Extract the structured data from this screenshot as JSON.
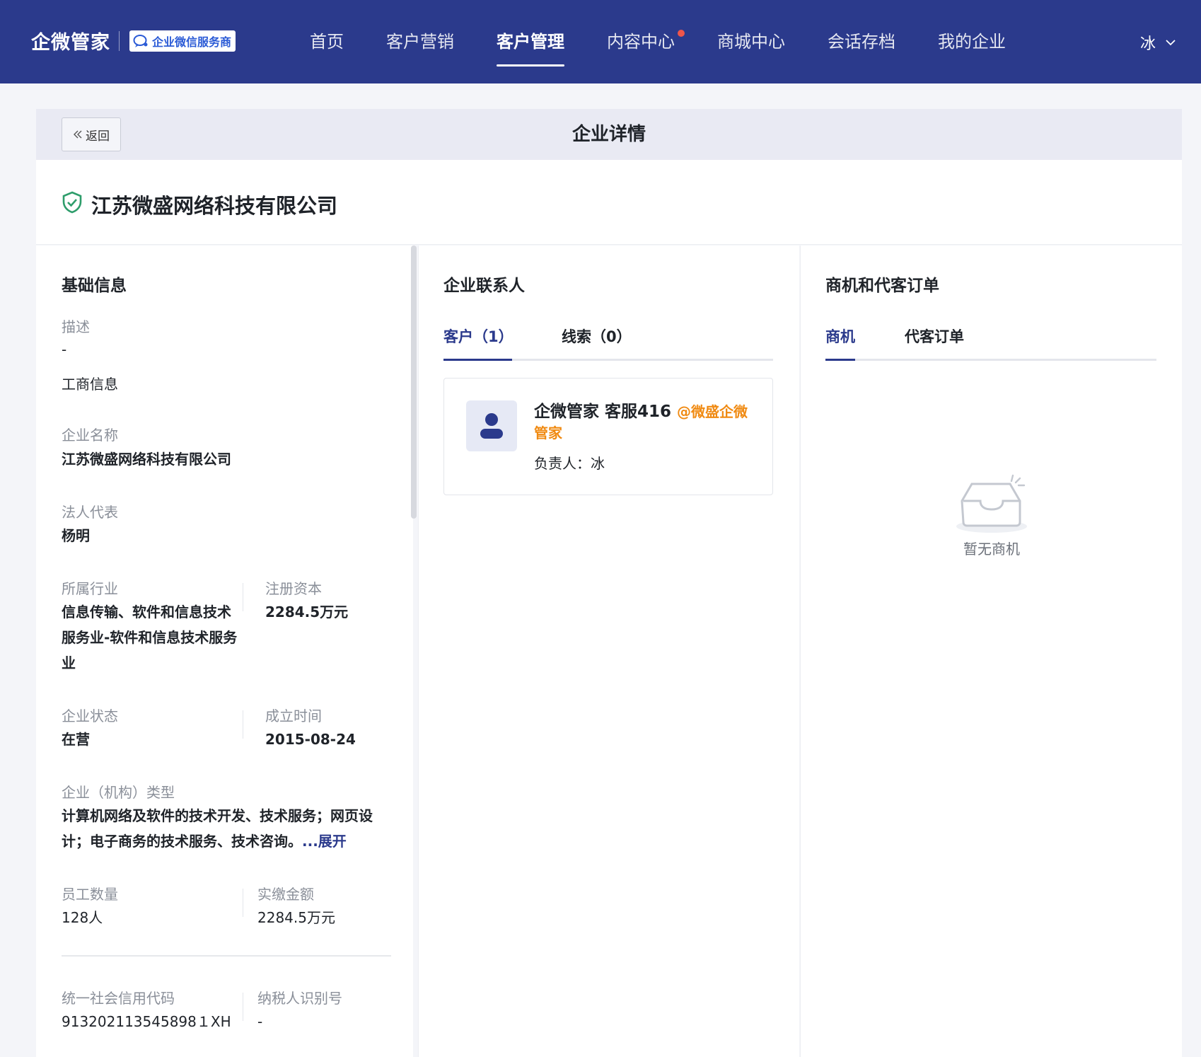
{
  "brand": {
    "name": "企微管家",
    "badge": "企业微信服务商"
  },
  "nav": {
    "items": [
      {
        "label": "首页",
        "active": false,
        "dot": false
      },
      {
        "label": "客户营销",
        "active": false,
        "dot": false
      },
      {
        "label": "客户管理",
        "active": true,
        "dot": false
      },
      {
        "label": "内容中心",
        "active": false,
        "dot": true
      },
      {
        "label": "商城中心",
        "active": false,
        "dot": false
      },
      {
        "label": "会话存档",
        "active": false,
        "dot": false
      },
      {
        "label": "我的企业",
        "active": false,
        "dot": false
      }
    ],
    "user": "冰"
  },
  "header": {
    "back_label": "返回",
    "title": "企业详情"
  },
  "company": {
    "name": "江苏微盛网络科技有限公司"
  },
  "basic": {
    "title": "基础信息",
    "desc_label": "描述",
    "desc_value": "-",
    "biz_heading": "工商信息",
    "name_label": "企业名称",
    "name_value": "江苏微盛网络科技有限公司",
    "legal_label": "法人代表",
    "legal_value": "杨明",
    "industry_label": "所属行业",
    "industry_value": "信息传输、软件和信息技术服务业-软件和信息技术服务业",
    "capital_label": "注册资本",
    "capital_value": "2284.5万元",
    "status_label": "企业状态",
    "status_value": "在营",
    "founded_label": "成立时间",
    "founded_value": "2015-08-24",
    "type_label": "企业（机构）类型",
    "type_value": "计算机网络及软件的技术开发、技术服务；网页设计；电子商务的技术服务、技术咨询。",
    "expand_label": "...展开",
    "staff_label": "员工数量",
    "staff_value": "128人",
    "paid_label": "实缴金额",
    "paid_value": "2284.5万元",
    "credit_label": "统一社会信用代码",
    "credit_value": "913202113545898１XH",
    "tax_label": "纳税人识别号",
    "tax_value": "-"
  },
  "contacts": {
    "title": "企业联系人",
    "tabs": [
      {
        "label": "客户（1）",
        "active": true
      },
      {
        "label": "线索（0）",
        "active": false
      }
    ],
    "card": {
      "name": "企微管家 客服416",
      "org": "@微盛企微管家",
      "owner": "负责人：冰"
    }
  },
  "opps": {
    "title": "商机和代客订单",
    "tabs": [
      {
        "label": "商机",
        "active": true
      },
      {
        "label": "代客订单",
        "active": false
      }
    ],
    "empty_text": "暂无商机"
  },
  "colors": {
    "nav_bg": "#2b3a8c",
    "accent": "#2b3a8c",
    "org_tag": "#f08a12",
    "verified": "#2e9d6b"
  }
}
